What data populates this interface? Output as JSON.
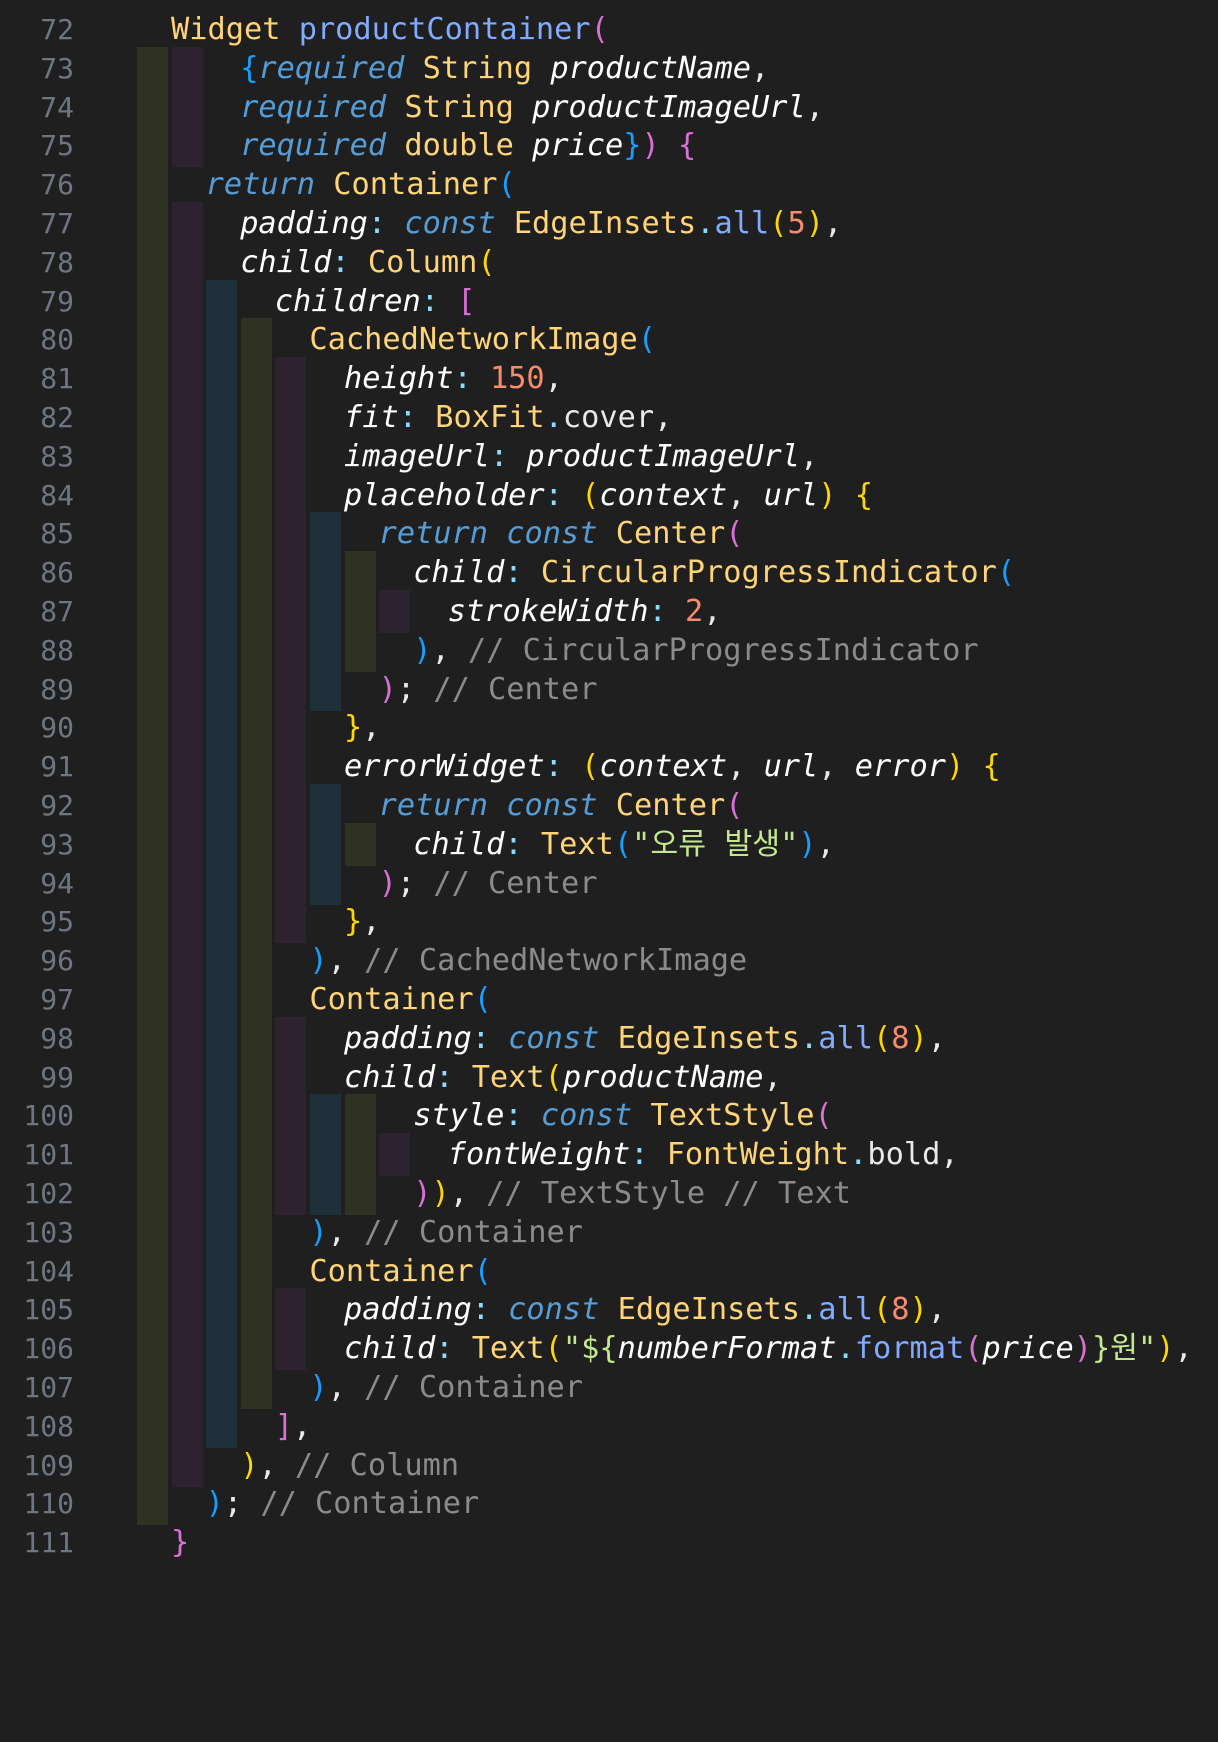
{
  "editor": {
    "guide_colors": [
      "#2f3122",
      "#2d2330",
      "#20303a"
    ],
    "syntax_colors": {
      "keyword": "#569cd6",
      "class": "#ffd479",
      "function": "#82aaff",
      "param": "#ffffff",
      "number": "#f78c6c",
      "string": "#c3e88d",
      "comment": "#8b8b8b",
      "bracket_level_1": "#ffd700",
      "bracket_level_2": "#da70d6",
      "bracket_level_3": "#179fff"
    },
    "lines": [
      {
        "number": "72",
        "depth": 0,
        "indent": 0,
        "tokens": [
          [
            "Widget",
            "c"
          ],
          [
            " ",
            ""
          ],
          [
            "productContainer",
            "f"
          ],
          [
            "(",
            "b2"
          ]
        ]
      },
      {
        "number": "73",
        "depth": 2,
        "indent": 2,
        "tokens": [
          [
            "{",
            "b3"
          ],
          [
            "required",
            "k"
          ],
          [
            " ",
            ""
          ],
          [
            "String",
            "c"
          ],
          [
            " ",
            ""
          ],
          [
            "productName",
            "p"
          ],
          [
            ",",
            "pr"
          ]
        ]
      },
      {
        "number": "74",
        "depth": 2,
        "indent": 2,
        "tokens": [
          [
            "required",
            "k"
          ],
          [
            " ",
            ""
          ],
          [
            "String",
            "c"
          ],
          [
            " ",
            ""
          ],
          [
            "productImageUrl",
            "p"
          ],
          [
            ",",
            "pr"
          ]
        ]
      },
      {
        "number": "75",
        "depth": 2,
        "indent": 2,
        "tokens": [
          [
            "required",
            "k"
          ],
          [
            " ",
            ""
          ],
          [
            "double",
            "c"
          ],
          [
            " ",
            ""
          ],
          [
            "price",
            "p"
          ],
          [
            "}",
            "b3"
          ],
          [
            ")",
            "b2"
          ],
          [
            " ",
            ""
          ],
          [
            "{",
            "b2"
          ]
        ]
      },
      {
        "number": "76",
        "depth": 1,
        "indent": 1,
        "tokens": [
          [
            "return",
            "k"
          ],
          [
            " ",
            ""
          ],
          [
            "Container",
            "c"
          ],
          [
            "(",
            "b3"
          ]
        ]
      },
      {
        "number": "77",
        "depth": 2,
        "indent": 2,
        "tokens": [
          [
            "padding",
            "p"
          ],
          [
            ": ",
            "pu"
          ],
          [
            "const",
            "k"
          ],
          [
            " ",
            ""
          ],
          [
            "EdgeInsets",
            "c"
          ],
          [
            ".",
            "pu"
          ],
          [
            "all",
            "f"
          ],
          [
            "(",
            "b1"
          ],
          [
            "5",
            "n"
          ],
          [
            ")",
            "b1"
          ],
          [
            ",",
            "pr"
          ]
        ]
      },
      {
        "number": "78",
        "depth": 2,
        "indent": 2,
        "tokens": [
          [
            "child",
            "p"
          ],
          [
            ": ",
            "pu"
          ],
          [
            "Column",
            "c"
          ],
          [
            "(",
            "b1"
          ]
        ]
      },
      {
        "number": "79",
        "depth": 3,
        "indent": 3,
        "tokens": [
          [
            "children",
            "p"
          ],
          [
            ": ",
            "pu"
          ],
          [
            "[",
            "b2"
          ]
        ]
      },
      {
        "number": "80",
        "depth": 4,
        "indent": 4,
        "tokens": [
          [
            "CachedNetworkImage",
            "c"
          ],
          [
            "(",
            "b3"
          ]
        ]
      },
      {
        "number": "81",
        "depth": 5,
        "indent": 5,
        "tokens": [
          [
            "height",
            "p"
          ],
          [
            ": ",
            "pu"
          ],
          [
            "150",
            "n"
          ],
          [
            ",",
            "pr"
          ]
        ]
      },
      {
        "number": "82",
        "depth": 5,
        "indent": 5,
        "tokens": [
          [
            "fit",
            "p"
          ],
          [
            ": ",
            "pu"
          ],
          [
            "BoxFit",
            "c"
          ],
          [
            ".",
            "pu"
          ],
          [
            "cover",
            "pr"
          ],
          [
            ",",
            "pr"
          ]
        ]
      },
      {
        "number": "83",
        "depth": 5,
        "indent": 5,
        "tokens": [
          [
            "imageUrl",
            "p"
          ],
          [
            ": ",
            "pu"
          ],
          [
            "productImageUrl",
            "p"
          ],
          [
            ",",
            "pr"
          ]
        ]
      },
      {
        "number": "84",
        "depth": 5,
        "indent": 5,
        "tokens": [
          [
            "placeholder",
            "p"
          ],
          [
            ": ",
            "pu"
          ],
          [
            "(",
            "b1"
          ],
          [
            "context",
            "p"
          ],
          [
            ", ",
            "pr"
          ],
          [
            "url",
            "p"
          ],
          [
            ")",
            "b1"
          ],
          [
            " ",
            ""
          ],
          [
            "{",
            "b1"
          ]
        ]
      },
      {
        "number": "85",
        "depth": 6,
        "indent": 6,
        "tokens": [
          [
            "return",
            "k"
          ],
          [
            " ",
            ""
          ],
          [
            "const",
            "k"
          ],
          [
            " ",
            ""
          ],
          [
            "Center",
            "c"
          ],
          [
            "(",
            "b2"
          ]
        ]
      },
      {
        "number": "86",
        "depth": 7,
        "indent": 7,
        "tokens": [
          [
            "child",
            "p"
          ],
          [
            ": ",
            "pu"
          ],
          [
            "CircularProgressIndicator",
            "c"
          ],
          [
            "(",
            "b3"
          ]
        ]
      },
      {
        "number": "87",
        "depth": 8,
        "indent": 8,
        "tokens": [
          [
            "strokeWidth",
            "p"
          ],
          [
            ": ",
            "pu"
          ],
          [
            "2",
            "n"
          ],
          [
            ",",
            "pr"
          ]
        ]
      },
      {
        "number": "88",
        "depth": 7,
        "indent": 7,
        "tokens": [
          [
            ")",
            "b3"
          ],
          [
            ", ",
            "pr"
          ],
          [
            "// CircularProgressIndicator",
            "cm"
          ]
        ]
      },
      {
        "number": "89",
        "depth": 6,
        "indent": 6,
        "tokens": [
          [
            ")",
            "b2"
          ],
          [
            "; ",
            "pr"
          ],
          [
            "// Center",
            "cm"
          ]
        ]
      },
      {
        "number": "90",
        "depth": 5,
        "indent": 5,
        "tokens": [
          [
            "}",
            "b1"
          ],
          [
            ",",
            "pr"
          ]
        ]
      },
      {
        "number": "91",
        "depth": 5,
        "indent": 5,
        "tokens": [
          [
            "errorWidget",
            "p"
          ],
          [
            ": ",
            "pu"
          ],
          [
            "(",
            "b1"
          ],
          [
            "context",
            "p"
          ],
          [
            ", ",
            "pr"
          ],
          [
            "url",
            "p"
          ],
          [
            ", ",
            "pr"
          ],
          [
            "error",
            "p"
          ],
          [
            ")",
            "b1"
          ],
          [
            " ",
            ""
          ],
          [
            "{",
            "b1"
          ]
        ]
      },
      {
        "number": "92",
        "depth": 6,
        "indent": 6,
        "tokens": [
          [
            "return",
            "k"
          ],
          [
            " ",
            ""
          ],
          [
            "const",
            "k"
          ],
          [
            " ",
            ""
          ],
          [
            "Center",
            "c"
          ],
          [
            "(",
            "b2"
          ]
        ]
      },
      {
        "number": "93",
        "depth": 7,
        "indent": 7,
        "tokens": [
          [
            "child",
            "p"
          ],
          [
            ": ",
            "pu"
          ],
          [
            "Text",
            "c"
          ],
          [
            "(",
            "b3"
          ],
          [
            "\"오류 발생\"",
            "s"
          ],
          [
            ")",
            "b3"
          ],
          [
            ",",
            "pr"
          ]
        ]
      },
      {
        "number": "94",
        "depth": 6,
        "indent": 6,
        "tokens": [
          [
            ")",
            "b2"
          ],
          [
            "; ",
            "pr"
          ],
          [
            "// Center",
            "cm"
          ]
        ]
      },
      {
        "number": "95",
        "depth": 5,
        "indent": 5,
        "tokens": [
          [
            "}",
            "b1"
          ],
          [
            ",",
            "pr"
          ]
        ]
      },
      {
        "number": "96",
        "depth": 4,
        "indent": 4,
        "tokens": [
          [
            ")",
            "b3"
          ],
          [
            ", ",
            "pr"
          ],
          [
            "// CachedNetworkImage",
            "cm"
          ]
        ]
      },
      {
        "number": "97",
        "depth": 4,
        "indent": 4,
        "tokens": [
          [
            "Container",
            "c"
          ],
          [
            "(",
            "b3"
          ]
        ]
      },
      {
        "number": "98",
        "depth": 5,
        "indent": 5,
        "tokens": [
          [
            "padding",
            "p"
          ],
          [
            ": ",
            "pu"
          ],
          [
            "const",
            "k"
          ],
          [
            " ",
            ""
          ],
          [
            "EdgeInsets",
            "c"
          ],
          [
            ".",
            "pu"
          ],
          [
            "all",
            "f"
          ],
          [
            "(",
            "b1"
          ],
          [
            "8",
            "n"
          ],
          [
            ")",
            "b1"
          ],
          [
            ",",
            "pr"
          ]
        ]
      },
      {
        "number": "99",
        "depth": 5,
        "indent": 5,
        "tokens": [
          [
            "child",
            "p"
          ],
          [
            ": ",
            "pu"
          ],
          [
            "Text",
            "c"
          ],
          [
            "(",
            "b1"
          ],
          [
            "productName",
            "p"
          ],
          [
            ",",
            "pr"
          ]
        ]
      },
      {
        "number": "100",
        "depth": 7,
        "indent": 7,
        "tokens": [
          [
            "style",
            "p"
          ],
          [
            ": ",
            "pu"
          ],
          [
            "const",
            "k"
          ],
          [
            " ",
            ""
          ],
          [
            "TextStyle",
            "c"
          ],
          [
            "(",
            "b2"
          ]
        ]
      },
      {
        "number": "101",
        "depth": 8,
        "indent": 8,
        "tokens": [
          [
            "fontWeight",
            "p"
          ],
          [
            ": ",
            "pu"
          ],
          [
            "FontWeight",
            "c"
          ],
          [
            ".",
            "pu"
          ],
          [
            "bold",
            "pr"
          ],
          [
            ",",
            "pr"
          ]
        ]
      },
      {
        "number": "102",
        "depth": 7,
        "indent": 7,
        "tokens": [
          [
            ")",
            "b2"
          ],
          [
            ")",
            "b1"
          ],
          [
            ", ",
            "pr"
          ],
          [
            "// TextStyle // Text",
            "cm"
          ]
        ]
      },
      {
        "number": "103",
        "depth": 4,
        "indent": 4,
        "tokens": [
          [
            ")",
            "b3"
          ],
          [
            ", ",
            "pr"
          ],
          [
            "// Container",
            "cm"
          ]
        ]
      },
      {
        "number": "104",
        "depth": 4,
        "indent": 4,
        "tokens": [
          [
            "Container",
            "c"
          ],
          [
            "(",
            "b3"
          ]
        ]
      },
      {
        "number": "105",
        "depth": 5,
        "indent": 5,
        "tokens": [
          [
            "padding",
            "p"
          ],
          [
            ": ",
            "pu"
          ],
          [
            "const",
            "k"
          ],
          [
            " ",
            ""
          ],
          [
            "EdgeInsets",
            "c"
          ],
          [
            ".",
            "pu"
          ],
          [
            "all",
            "f"
          ],
          [
            "(",
            "b1"
          ],
          [
            "8",
            "n"
          ],
          [
            ")",
            "b1"
          ],
          [
            ",",
            "pr"
          ]
        ]
      },
      {
        "number": "106",
        "depth": 5,
        "indent": 5,
        "tokens": [
          [
            "child",
            "p"
          ],
          [
            ": ",
            "pu"
          ],
          [
            "Text",
            "c"
          ],
          [
            "(",
            "b1"
          ],
          [
            "\"${",
            "s"
          ],
          [
            "numberFormat",
            "p"
          ],
          [
            ".",
            "pu"
          ],
          [
            "format",
            "f"
          ],
          [
            "(",
            "b2"
          ],
          [
            "price",
            "p"
          ],
          [
            ")",
            "b2"
          ],
          [
            "}원\"",
            "s"
          ],
          [
            ")",
            "b1"
          ],
          [
            ",",
            "pr"
          ]
        ]
      },
      {
        "number": "107",
        "depth": 4,
        "indent": 4,
        "tokens": [
          [
            ")",
            "b3"
          ],
          [
            ", ",
            "pr"
          ],
          [
            "// Container",
            "cm"
          ]
        ]
      },
      {
        "number": "108",
        "depth": 3,
        "indent": 3,
        "tokens": [
          [
            "]",
            "b2"
          ],
          [
            ",",
            "pr"
          ]
        ]
      },
      {
        "number": "109",
        "depth": 2,
        "indent": 2,
        "tokens": [
          [
            ")",
            "b1"
          ],
          [
            ", ",
            "pr"
          ],
          [
            "// Column",
            "cm"
          ]
        ]
      },
      {
        "number": "110",
        "depth": 1,
        "indent": 1,
        "tokens": [
          [
            ")",
            "b3"
          ],
          [
            "; ",
            "pr"
          ],
          [
            "// Container",
            "cm"
          ]
        ]
      },
      {
        "number": "111",
        "depth": 0,
        "indent": 0,
        "tokens": [
          [
            "}",
            "b2"
          ]
        ]
      }
    ]
  }
}
